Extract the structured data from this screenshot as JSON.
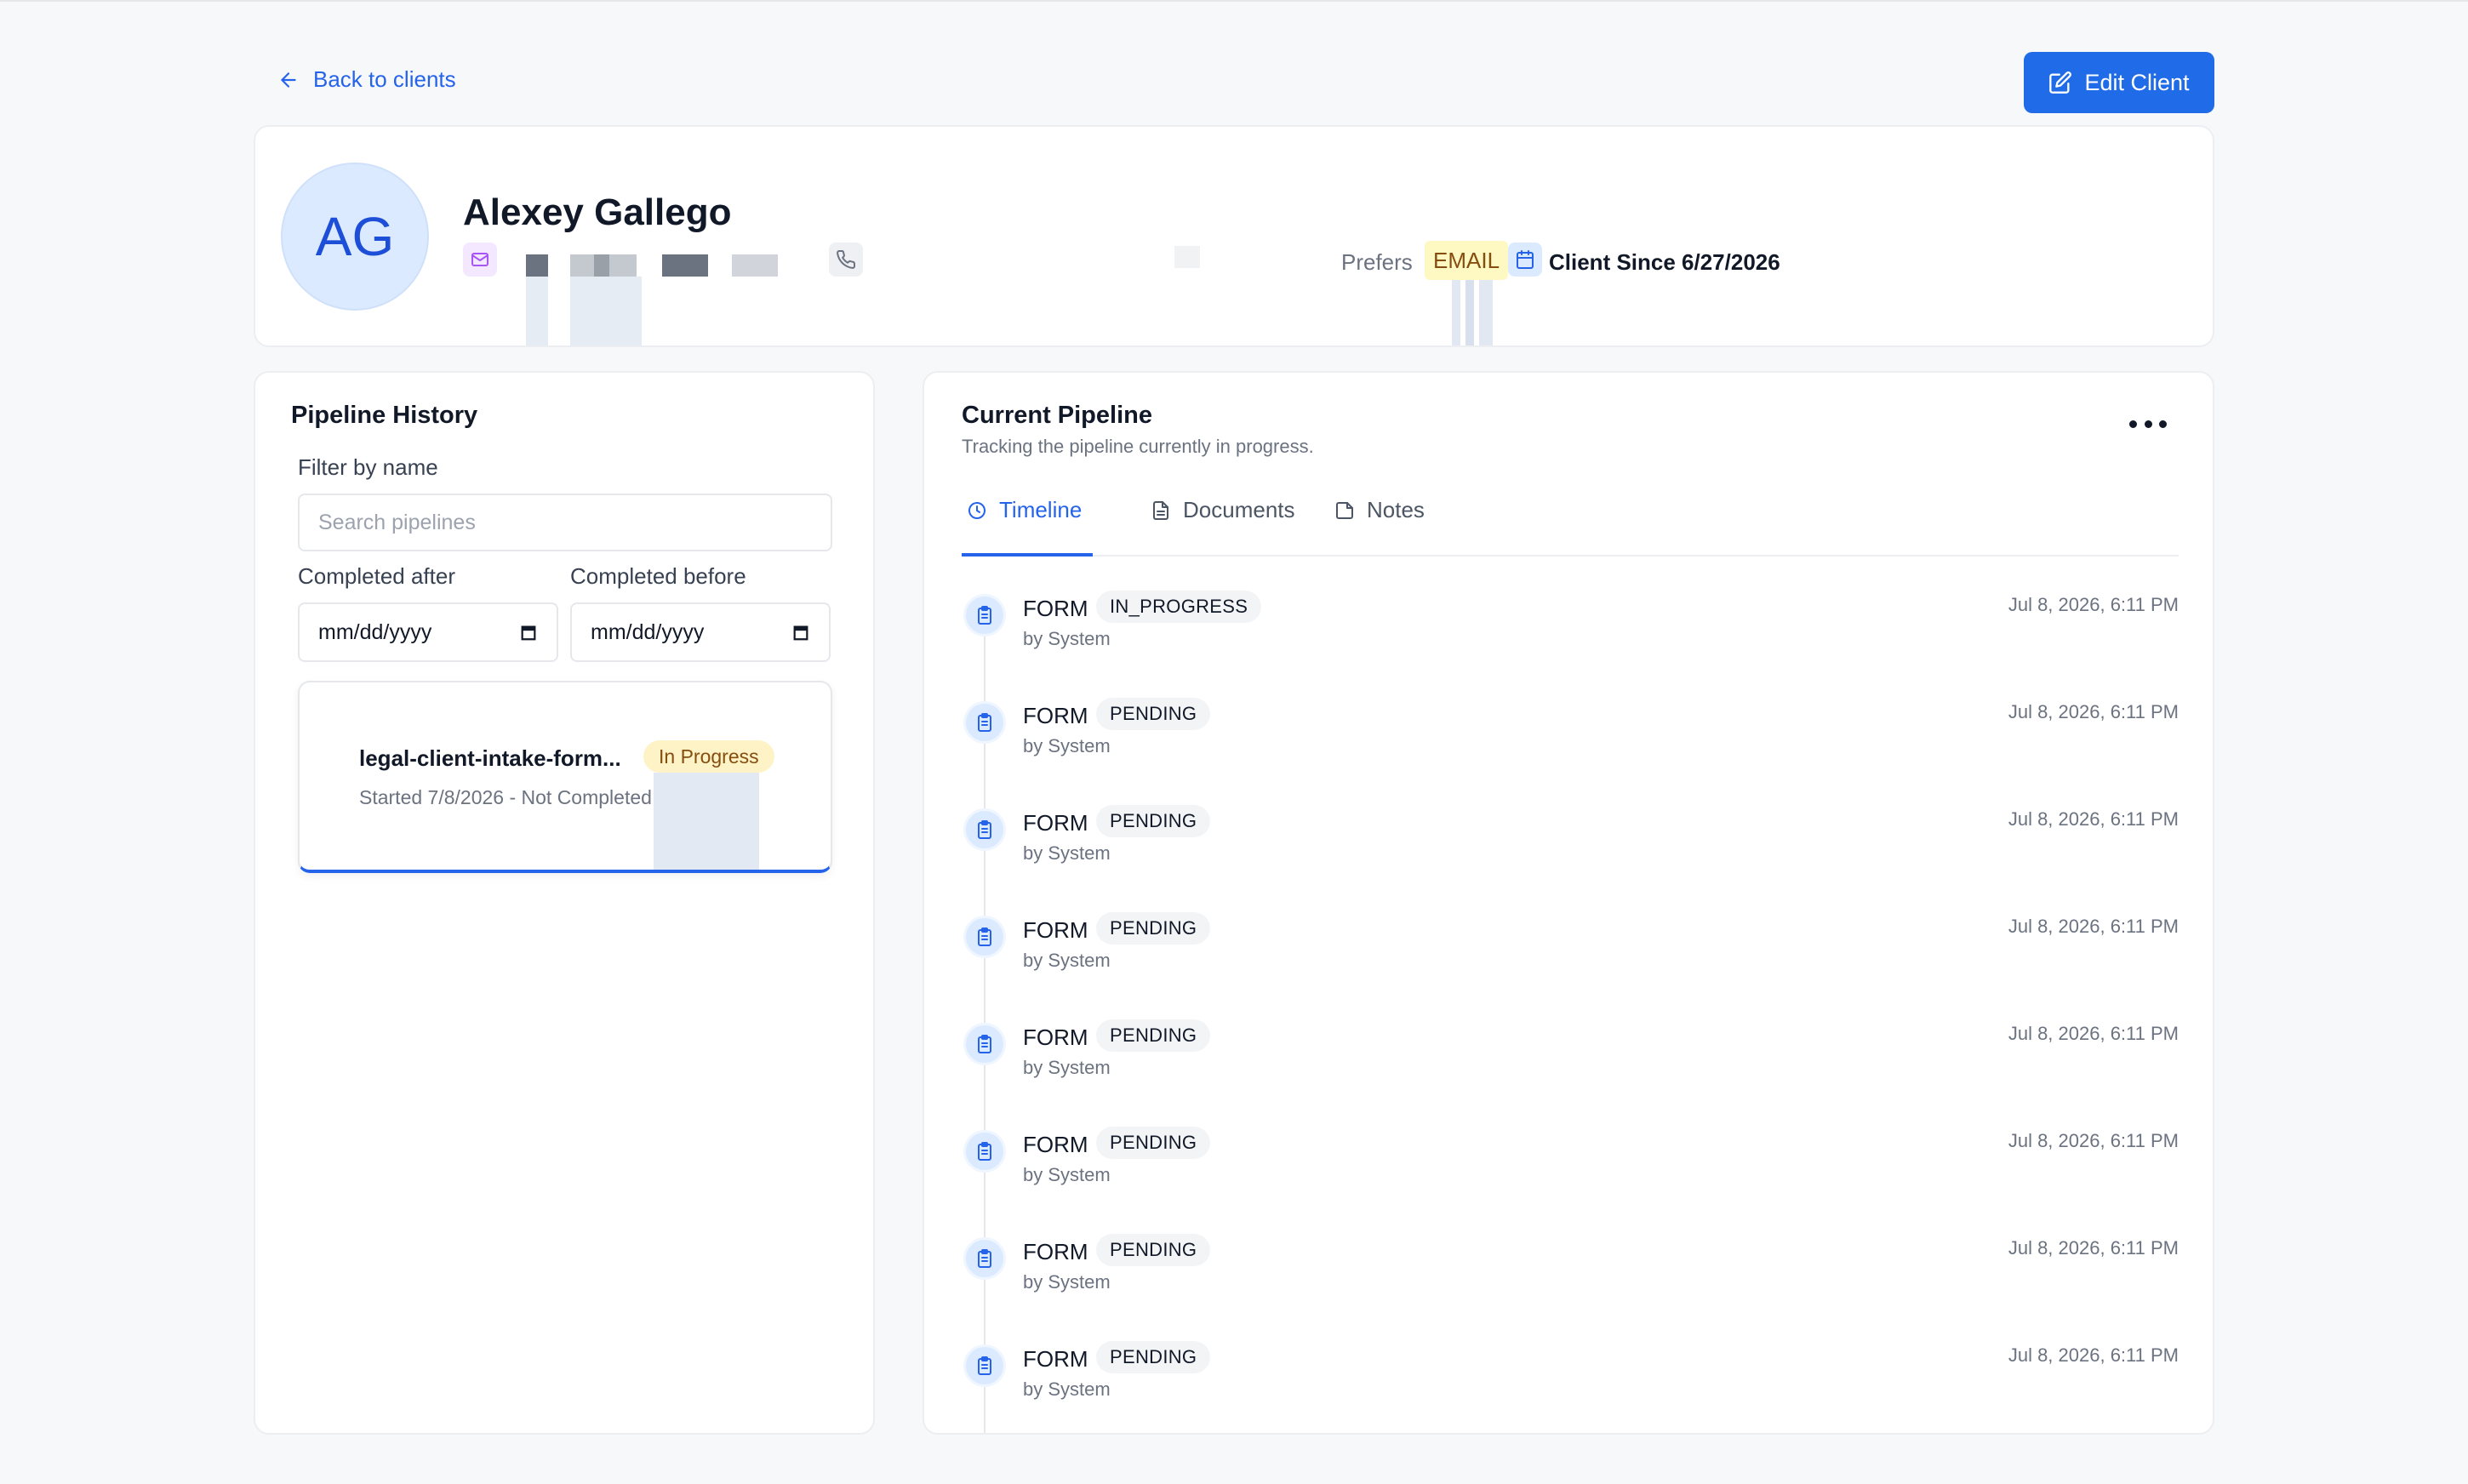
{
  "nav": {
    "back_label": "Back to clients"
  },
  "actions": {
    "edit_label": "Edit Client"
  },
  "client": {
    "initials": "AG",
    "name": "Alexey Gallego",
    "prefers_label": "Prefers",
    "prefers_value": "EMAIL",
    "since": "Client Since 6/27/2026"
  },
  "history": {
    "title": "Pipeline History",
    "filter_label": "Filter by name",
    "search_placeholder": "Search pipelines",
    "after_label": "Completed after",
    "before_label": "Completed before",
    "date_placeholder": "mm/dd/yyyy",
    "items": [
      {
        "name": "legal-client-intake-form...",
        "status": "In Progress",
        "subtitle": "Started 7/8/2026 - Not Completed"
      }
    ]
  },
  "current": {
    "title": "Current Pipeline",
    "subtitle": "Tracking the pipeline currently in progress.",
    "tabs": [
      {
        "label": "Timeline",
        "icon": "clock-icon"
      },
      {
        "label": "Documents",
        "icon": "document-icon"
      },
      {
        "label": "Notes",
        "icon": "note-icon"
      }
    ],
    "events": [
      {
        "type": "FORM",
        "status": "IN_PROGRESS",
        "by": "by System",
        "time": "Jul 8, 2026, 6:11 PM"
      },
      {
        "type": "FORM",
        "status": "PENDING",
        "by": "by System",
        "time": "Jul 8, 2026, 6:11 PM"
      },
      {
        "type": "FORM",
        "status": "PENDING",
        "by": "by System",
        "time": "Jul 8, 2026, 6:11 PM"
      },
      {
        "type": "FORM",
        "status": "PENDING",
        "by": "by System",
        "time": "Jul 8, 2026, 6:11 PM"
      },
      {
        "type": "FORM",
        "status": "PENDING",
        "by": "by System",
        "time": "Jul 8, 2026, 6:11 PM"
      },
      {
        "type": "FORM",
        "status": "PENDING",
        "by": "by System",
        "time": "Jul 8, 2026, 6:11 PM"
      },
      {
        "type": "FORM",
        "status": "PENDING",
        "by": "by System",
        "time": "Jul 8, 2026, 6:11 PM"
      },
      {
        "type": "FORM",
        "status": "PENDING",
        "by": "by System",
        "time": "Jul 8, 2026, 6:11 PM"
      }
    ]
  },
  "colors": {
    "accent": "#2563eb",
    "badge_yellow": "#fef9c3",
    "page_bg": "#f7f8fa"
  }
}
